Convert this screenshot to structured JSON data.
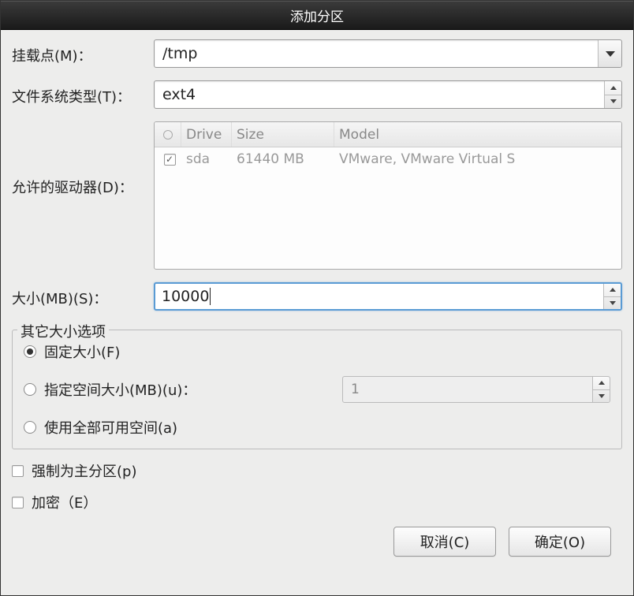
{
  "window": {
    "title": "添加分区"
  },
  "labels": {
    "mount_point": "挂载点(M)：",
    "fs_type": "文件系统类型(T)：",
    "allowed_drives": "允许的驱动器(D)：",
    "size": "大小(MB)(S)："
  },
  "fields": {
    "mount_point_value": "/tmp",
    "fs_type_value": "ext4",
    "size_value": "10000"
  },
  "drive_table": {
    "headers": {
      "drive": "Drive",
      "size": "Size",
      "model": "Model"
    },
    "rows": [
      {
        "checked": true,
        "drive": "sda",
        "size": "61440 MB",
        "model": "VMware, VMware Virtual S"
      }
    ]
  },
  "size_options": {
    "legend": "其它大小选项",
    "fixed": "固定大小(F)",
    "fill_up_to": "指定空间大小(MB)(u)：",
    "fill_up_to_value": "1",
    "all_space": "使用全部可用空间(a)",
    "selected": "fixed"
  },
  "checkboxes": {
    "primary": "强制为主分区(p)",
    "encrypt": "加密（E）"
  },
  "buttons": {
    "cancel": "取消(C)",
    "ok": "确定(O)"
  }
}
